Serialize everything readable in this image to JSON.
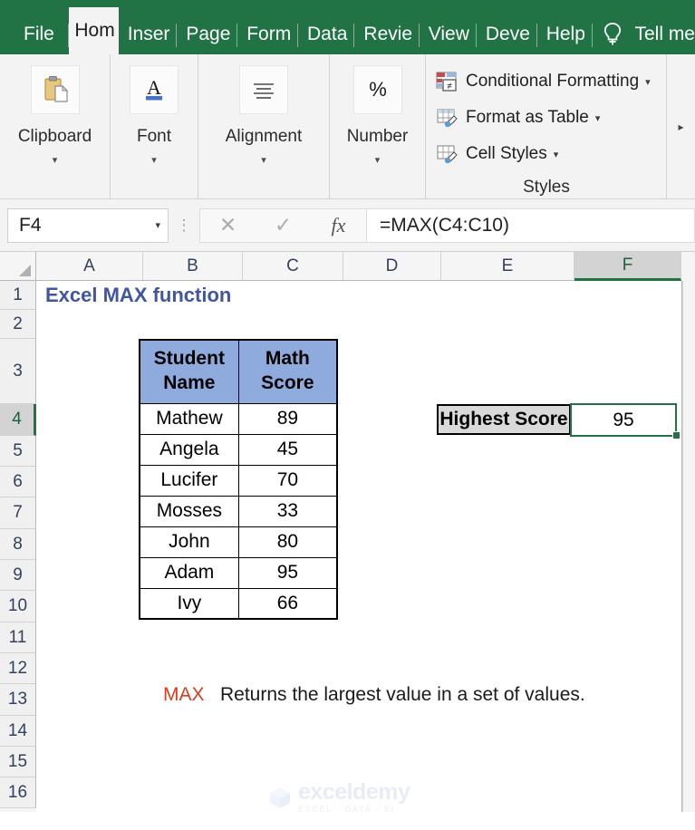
{
  "tabs": [
    {
      "label": "File",
      "active": false
    },
    {
      "label": "Hom",
      "active": true
    },
    {
      "label": "Inser",
      "active": false
    },
    {
      "label": "Page",
      "active": false
    },
    {
      "label": "Form",
      "active": false
    },
    {
      "label": "Data",
      "active": false
    },
    {
      "label": "Revie",
      "active": false
    },
    {
      "label": "View",
      "active": false
    },
    {
      "label": "Deve",
      "active": false
    },
    {
      "label": "Help",
      "active": false
    }
  ],
  "tellme": {
    "icon": "lightbulb-icon",
    "label": "Tell me"
  },
  "ribbon": {
    "groups": [
      {
        "id": "clipboard",
        "label": "Clipboard",
        "icon": "clipboard-icon",
        "caret": "▾"
      },
      {
        "id": "font",
        "label": "Font",
        "icon": "font-letter-a-icon",
        "caret": "▾"
      },
      {
        "id": "alignment",
        "label": "Alignment",
        "icon": "alignment-lines-icon",
        "caret": "▾"
      },
      {
        "id": "number",
        "label": "Number",
        "icon": "percent-icon",
        "caret": "▾"
      }
    ],
    "styles": {
      "title": "Styles",
      "items": [
        {
          "label": "Conditional Formatting",
          "icon": "conditional-formatting-icon",
          "caret": "▾"
        },
        {
          "label": "Format as Table",
          "icon": "format-as-table-icon",
          "caret": "▾"
        },
        {
          "label": "Cell Styles",
          "icon": "cell-styles-icon",
          "caret": "▾"
        }
      ]
    },
    "expand_arrow": "▸"
  },
  "formula_bar": {
    "name_box_value": "F4",
    "name_box_caret": "▾",
    "cancel_icon": "✕",
    "confirm_icon": "✓",
    "fx_label": "fx",
    "formula": "=MAX(C4:C10)"
  },
  "grid": {
    "columns": [
      {
        "label": "A",
        "width": 118,
        "selected": false
      },
      {
        "label": "B",
        "width": 110,
        "selected": false
      },
      {
        "label": "C",
        "width": 111,
        "selected": false
      },
      {
        "label": "D",
        "width": 108,
        "selected": false
      },
      {
        "label": "E",
        "width": 147,
        "selected": false
      },
      {
        "label": "F",
        "width": 118,
        "selected": true
      }
    ],
    "rows": [
      {
        "label": "1",
        "height": 32,
        "selected": false
      },
      {
        "label": "2",
        "height": 32,
        "selected": false
      },
      {
        "label": "3",
        "height": 72,
        "selected": false
      },
      {
        "label": "4",
        "height": 35,
        "selected": true
      },
      {
        "label": "5",
        "height": 34,
        "selected": false
      },
      {
        "label": "6",
        "height": 34,
        "selected": false
      },
      {
        "label": "7",
        "height": 35,
        "selected": false
      },
      {
        "label": "8",
        "height": 34,
        "selected": false
      },
      {
        "label": "9",
        "height": 34,
        "selected": false
      },
      {
        "label": "10",
        "height": 35,
        "selected": false
      },
      {
        "label": "11",
        "height": 34,
        "selected": false
      },
      {
        "label": "12",
        "height": 34,
        "selected": false
      },
      {
        "label": "13",
        "height": 35,
        "selected": false
      },
      {
        "label": "14",
        "height": 34,
        "selected": false
      },
      {
        "label": "15",
        "height": 34,
        "selected": false
      },
      {
        "label": "16",
        "height": 34,
        "selected": false
      }
    ]
  },
  "sheet": {
    "title": "Excel MAX function",
    "table": {
      "headers": [
        "Student Name",
        "Math Score"
      ],
      "header_lines": [
        [
          "Student",
          "Name"
        ],
        [
          "Math",
          "Score"
        ]
      ],
      "rows": [
        {
          "name": "Mathew",
          "score": "89"
        },
        {
          "name": "Angela",
          "score": "45"
        },
        {
          "name": "Lucifer",
          "score": "70"
        },
        {
          "name": "Mosses",
          "score": "33"
        },
        {
          "name": "John",
          "score": "80"
        },
        {
          "name": "Adam",
          "score": "95"
        },
        {
          "name": "Ivy",
          "score": "66"
        }
      ],
      "header_fill": "#8FAADC"
    },
    "result": {
      "label": "Highest Score",
      "value": "95",
      "label_fill": "#D9D9D9",
      "selection_color": "#217346"
    },
    "note": {
      "function_name": "MAX",
      "description": "Returns the largest value in a set of values.",
      "function_name_color": "#E03A20"
    }
  },
  "watermark": {
    "main": "exceldemy",
    "sub": "EXCEL - DATA - BI",
    "icon": "exceldemy-cube-logo"
  }
}
